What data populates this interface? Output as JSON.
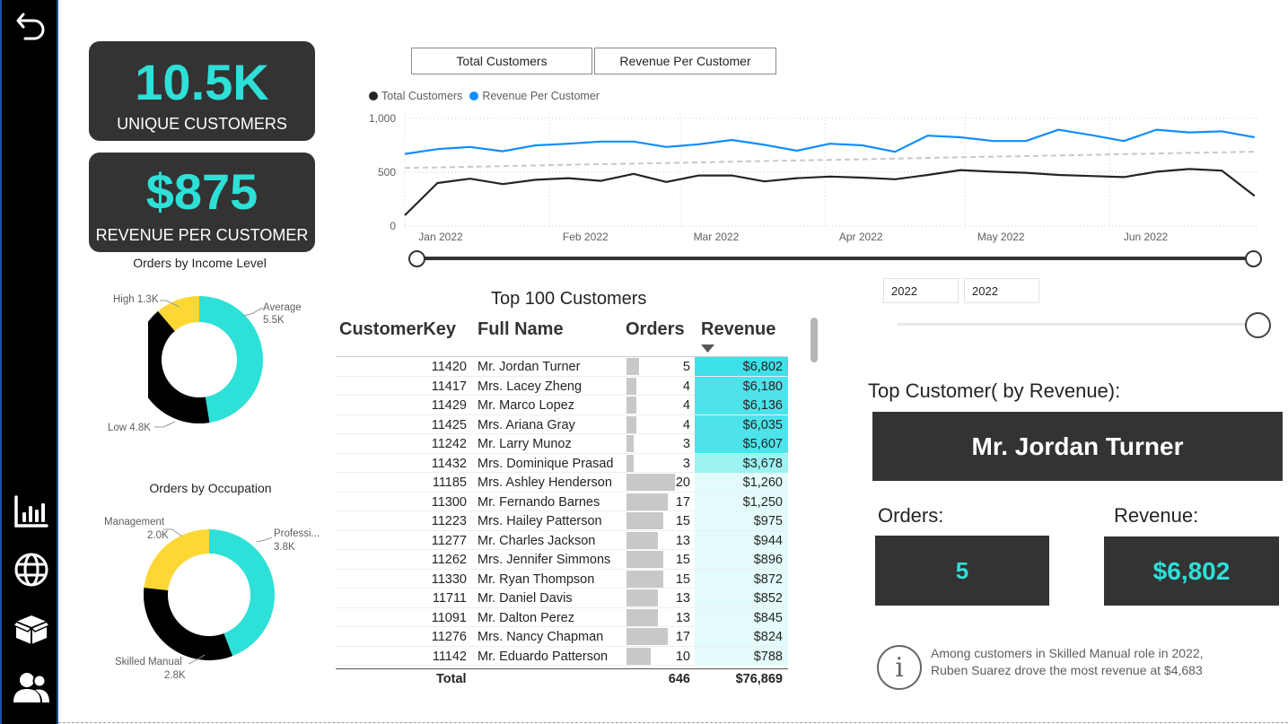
{
  "nav": {
    "back_icon": "back-arrow-icon",
    "items": [
      {
        "icon": "bar-chart-icon"
      },
      {
        "icon": "globe-icon"
      },
      {
        "icon": "box-icon"
      },
      {
        "icon": "people-icon"
      }
    ]
  },
  "kpis": {
    "unique_customers": {
      "value": "10.5K",
      "label": "UNIQUE CUSTOMERS"
    },
    "revenue_per_customer": {
      "value": "$875",
      "label": "REVENUE PER CUSTOMER"
    }
  },
  "colors": {
    "accent": "#2DE0D8",
    "dark": "#333333",
    "black": "#000000",
    "yellow": "#FDD835",
    "blue": "#118DFF",
    "trend": "#C8C8C8"
  },
  "income_chart": {
    "title": "Orders by Income Level",
    "labels": {
      "high": "High 1.3K",
      "average": "Average",
      "average_value": "5.5K",
      "low": "Low 4.8K"
    }
  },
  "occupation_chart": {
    "title": "Orders by Occupation",
    "labels": {
      "management": "Management",
      "management_value": "2.0K",
      "professional": "Professi...",
      "professional_value": "3.8K",
      "skilled": "Skilled Manual",
      "skilled_value": "2.8K"
    }
  },
  "line_chart": {
    "buttons": [
      "Total Customers",
      "Revenue Per Customer"
    ],
    "legend": [
      "Total Customers",
      "Revenue Per Customer"
    ],
    "y_ticks": [
      "1,000",
      "500",
      "0"
    ],
    "x_ticks": [
      "Jan 2022",
      "Feb 2022",
      "Mar 2022",
      "Apr 2022",
      "May 2022",
      "Jun 2022"
    ]
  },
  "chart_data": [
    {
      "type": "pie",
      "title": "Orders by Income Level",
      "donut": true,
      "categories": [
        "Average",
        "Low",
        "High"
      ],
      "values": [
        5500,
        4800,
        1300
      ],
      "colors": [
        "#2DE0D8",
        "#000000",
        "#FDD835"
      ]
    },
    {
      "type": "pie",
      "title": "Orders by Occupation",
      "donut": true,
      "categories": [
        "Professional",
        "Skilled Manual",
        "Management"
      ],
      "values": [
        3800,
        2800,
        2000
      ],
      "colors": [
        "#2DE0D8",
        "#000000",
        "#FDD835"
      ]
    },
    {
      "type": "line",
      "ylim": [
        0,
        1050
      ],
      "x_range": [
        "2022-01-01",
        "2022-07-03"
      ],
      "x": [
        "2022-01-01",
        "2022-01-08",
        "2022-01-15",
        "2022-01-22",
        "2022-01-29",
        "2022-02-05",
        "2022-02-12",
        "2022-02-19",
        "2022-02-26",
        "2022-03-05",
        "2022-03-12",
        "2022-03-19",
        "2022-03-26",
        "2022-04-02",
        "2022-04-09",
        "2022-04-16",
        "2022-04-23",
        "2022-04-30",
        "2022-05-07",
        "2022-05-14",
        "2022-05-21",
        "2022-05-28",
        "2022-06-04",
        "2022-06-11",
        "2022-06-18",
        "2022-06-25",
        "2022-07-02"
      ],
      "series": [
        {
          "name": "Total Customers",
          "color": "#252423",
          "values": [
            100,
            400,
            440,
            390,
            430,
            445,
            420,
            485,
            410,
            470,
            470,
            415,
            445,
            460,
            450,
            435,
            475,
            520,
            505,
            495,
            475,
            465,
            455,
            505,
            530,
            515,
            280
          ]
        },
        {
          "name": "Revenue Per Customer",
          "color": "#118DFF",
          "values": [
            670,
            715,
            735,
            695,
            750,
            765,
            785,
            785,
            735,
            760,
            800,
            755,
            700,
            765,
            750,
            690,
            840,
            825,
            790,
            790,
            895,
            845,
            790,
            895,
            870,
            880,
            825
          ]
        },
        {
          "name": "",
          "color": "#C8C8C8",
          "dashed": true,
          "values": [
            540,
            545,
            551,
            557,
            563,
            569,
            575,
            580,
            586,
            592,
            598,
            604,
            610,
            615,
            621,
            627,
            633,
            639,
            645,
            650,
            656,
            662,
            668,
            674,
            680,
            685,
            691
          ]
        }
      ]
    }
  ],
  "date_slicer": {
    "start": "2022",
    "end": "2022"
  },
  "table": {
    "title": "Top 100 Customers",
    "headers": {
      "key": "CustomerKey",
      "name": "Full Name",
      "orders": "Orders",
      "revenue": "Revenue"
    },
    "rows": [
      {
        "key": "11420",
        "name": "Mr. Jordan Turner",
        "orders": 5,
        "revenue": "$6,802",
        "revenue_num": 6802
      },
      {
        "key": "11417",
        "name": "Mrs. Lacey Zheng",
        "orders": 4,
        "revenue": "$6,180",
        "revenue_num": 6180
      },
      {
        "key": "11429",
        "name": "Mr. Marco Lopez",
        "orders": 4,
        "revenue": "$6,136",
        "revenue_num": 6136
      },
      {
        "key": "11425",
        "name": "Mrs. Ariana Gray",
        "orders": 4,
        "revenue": "$6,035",
        "revenue_num": 6035
      },
      {
        "key": "11242",
        "name": "Mr. Larry Munoz",
        "orders": 3,
        "revenue": "$5,607",
        "revenue_num": 5607
      },
      {
        "key": "11432",
        "name": "Mrs. Dominique Prasad",
        "orders": 3,
        "revenue": "$3,678",
        "revenue_num": 3678
      },
      {
        "key": "11185",
        "name": "Mrs. Ashley Henderson",
        "orders": 20,
        "revenue": "$1,260",
        "revenue_num": 1260
      },
      {
        "key": "11300",
        "name": "Mr. Fernando Barnes",
        "orders": 17,
        "revenue": "$1,250",
        "revenue_num": 1250
      },
      {
        "key": "11223",
        "name": "Mrs. Hailey Patterson",
        "orders": 15,
        "revenue": "$975",
        "revenue_num": 975
      },
      {
        "key": "11277",
        "name": "Mr. Charles Jackson",
        "orders": 13,
        "revenue": "$944",
        "revenue_num": 944
      },
      {
        "key": "11262",
        "name": "Mrs. Jennifer Simmons",
        "orders": 15,
        "revenue": "$896",
        "revenue_num": 896
      },
      {
        "key": "11330",
        "name": "Mr. Ryan Thompson",
        "orders": 15,
        "revenue": "$872",
        "revenue_num": 872
      },
      {
        "key": "11711",
        "name": "Mr. Daniel Davis",
        "orders": 13,
        "revenue": "$852",
        "revenue_num": 852
      },
      {
        "key": "11091",
        "name": "Mr. Dalton Perez",
        "orders": 13,
        "revenue": "$845",
        "revenue_num": 845
      },
      {
        "key": "11276",
        "name": "Mrs. Nancy Chapman",
        "orders": 17,
        "revenue": "$824",
        "revenue_num": 824
      },
      {
        "key": "11142",
        "name": "Mr. Eduardo Patterson",
        "orders": 10,
        "revenue": "$788",
        "revenue_num": 788
      }
    ],
    "total": {
      "label": "Total",
      "orders": "646",
      "revenue": "$76,869"
    }
  },
  "top_customer": {
    "title": "Top Customer( by Revenue):",
    "name": "Mr. Jordan Turner",
    "orders_label": "Orders:",
    "orders_value": "5",
    "revenue_label": "Revenue:",
    "revenue_value": "$6,802"
  },
  "insight": {
    "line1": "Among customers in Skilled Manual role in 2022,",
    "line2": "Ruben Suarez drove the most revenue at $4,683",
    "icon": "info-icon"
  }
}
